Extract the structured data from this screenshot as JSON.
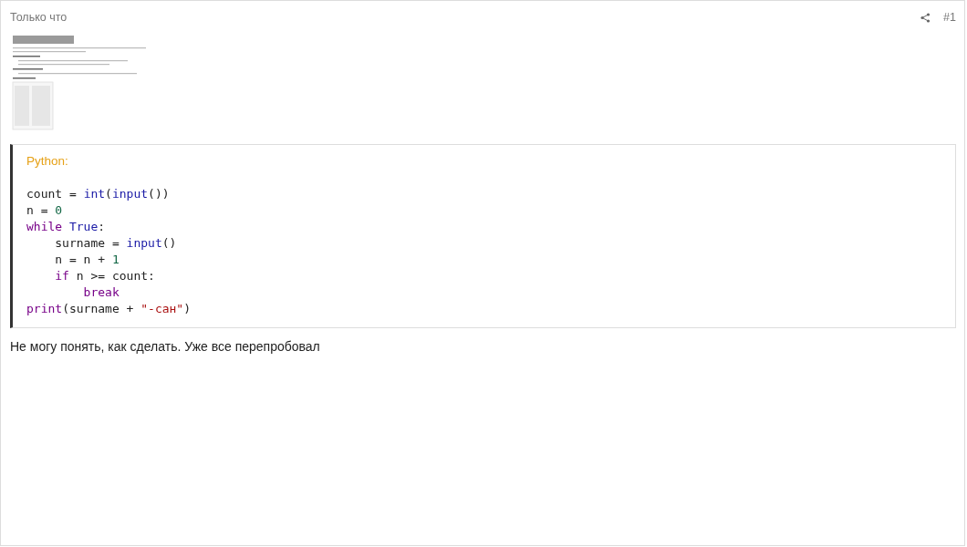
{
  "post": {
    "time": "Только что",
    "number": "#1"
  },
  "code": {
    "language": "Python:",
    "lines": [
      {
        "tokens": [
          {
            "kind": "plain",
            "text": "count = "
          },
          {
            "kind": "builtin",
            "text": "int"
          },
          {
            "kind": "plain",
            "text": "("
          },
          {
            "kind": "builtin",
            "text": "input"
          },
          {
            "kind": "plain",
            "text": "())"
          }
        ]
      },
      {
        "tokens": [
          {
            "kind": "plain",
            "text": "n = "
          },
          {
            "kind": "number",
            "text": "0"
          }
        ]
      },
      {
        "tokens": [
          {
            "kind": "keyword",
            "text": "while "
          },
          {
            "kind": "constant",
            "text": "True"
          },
          {
            "kind": "plain",
            "text": ":"
          }
        ],
        "children": [
          {
            "tokens": [
              {
                "kind": "plain",
                "text": "surname = "
              },
              {
                "kind": "builtin",
                "text": "input"
              },
              {
                "kind": "plain",
                "text": "()"
              }
            ]
          },
          {
            "tokens": [
              {
                "kind": "plain",
                "text": "n = n + "
              },
              {
                "kind": "number",
                "text": "1"
              }
            ]
          },
          {
            "tokens": [
              {
                "kind": "keyword",
                "text": "if"
              },
              {
                "kind": "plain",
                "text": " n >= count:"
              }
            ],
            "children": [
              {
                "tokens": [
                  {
                    "kind": "keyword",
                    "text": "break"
                  }
                ]
              }
            ]
          }
        ]
      },
      {
        "tokens": [
          {
            "kind": "keyword",
            "text": "print"
          },
          {
            "kind": "plain",
            "text": "(surname + "
          },
          {
            "kind": "string",
            "text": "\"-сан\""
          },
          {
            "kind": "plain",
            "text": ")"
          }
        ]
      }
    ]
  },
  "message": "Не могу понять, как сделать. Уже все перепробовал"
}
